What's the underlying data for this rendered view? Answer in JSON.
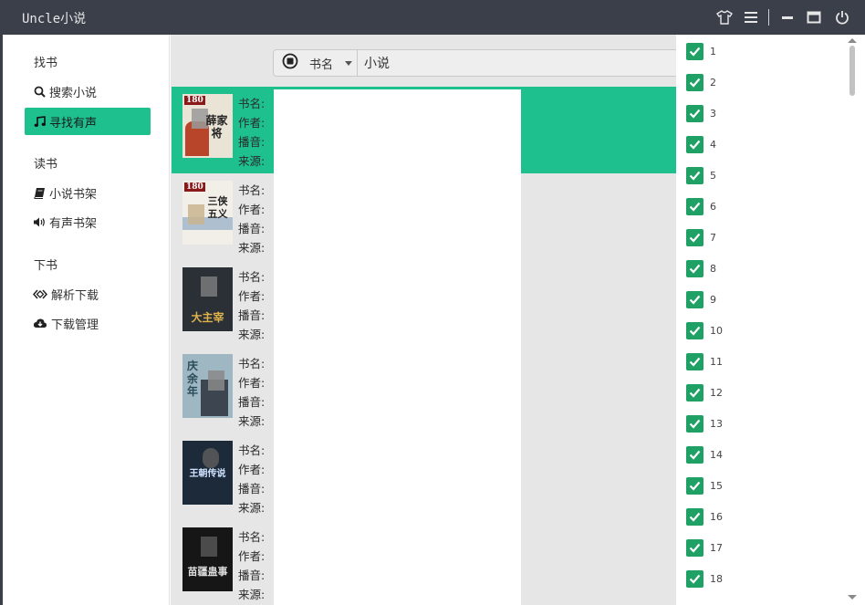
{
  "app": {
    "title": "Uncle小说"
  },
  "sidebar": {
    "sections": [
      {
        "title": "找书",
        "items": [
          {
            "label": "搜索小说",
            "icon": "search-icon"
          },
          {
            "label": "寻找有声",
            "icon": "music-icon",
            "active": true
          }
        ]
      },
      {
        "title": "读书",
        "items": [
          {
            "label": "小说书架",
            "icon": "book-icon"
          },
          {
            "label": "有声书架",
            "icon": "speaker-icon"
          }
        ]
      },
      {
        "title": "下书",
        "items": [
          {
            "label": "解析下载",
            "icon": "parse-icon"
          },
          {
            "label": "下载管理",
            "icon": "cloud-download-icon"
          }
        ]
      }
    ]
  },
  "search": {
    "type_label": "书名",
    "query": "小说"
  },
  "field_labels": {
    "name": "书名:",
    "author": "作者:",
    "narrator": "播音:",
    "source": "来源:"
  },
  "results": [
    {
      "cover_text": "薛家将",
      "cover_badge": "180",
      "selected": true
    },
    {
      "cover_text": "三侠五义",
      "cover_badge": "180",
      "selected": false
    },
    {
      "cover_text": "大主宰",
      "cover_badge": "",
      "selected": false
    },
    {
      "cover_text": "庆余年",
      "cover_badge": "",
      "selected": false
    },
    {
      "cover_text": "王朝传说",
      "cover_badge": "",
      "selected": false
    },
    {
      "cover_text": "苗疆蛊事",
      "cover_badge": "",
      "selected": false
    }
  ],
  "chapters": [
    "1",
    "2",
    "3",
    "4",
    "5",
    "6",
    "7",
    "8",
    "9",
    "10",
    "11",
    "12",
    "13",
    "14",
    "15",
    "16",
    "17",
    "18"
  ],
  "colors": {
    "accent": "#1ec08e",
    "titlebar": "#3b3f4a",
    "checkbox": "#1fa065"
  }
}
